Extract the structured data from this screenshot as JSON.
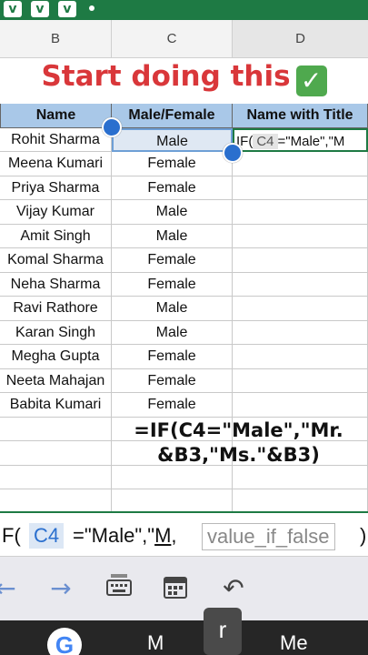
{
  "top_badges": [
    "v",
    "v",
    "v"
  ],
  "columns": [
    {
      "letter": "B",
      "selected": false
    },
    {
      "letter": "C",
      "selected": false
    },
    {
      "letter": "D",
      "selected": true
    }
  ],
  "title": "Start doing this",
  "title_icon": "check-mark-icon",
  "table": {
    "headers": [
      "Name",
      "Male/Female",
      "Name with Title"
    ],
    "rows": [
      [
        "Rohit Sharma",
        "Male"
      ],
      [
        "Meena Kumari",
        "Female"
      ],
      [
        "Priya Sharma",
        "Female"
      ],
      [
        "Vijay Kumar",
        "Male"
      ],
      [
        "Amit Singh",
        "Male"
      ],
      [
        "Komal Sharma",
        "Female"
      ],
      [
        "Neha Sharma",
        "Female"
      ],
      [
        "Ravi Rathore",
        "Male"
      ],
      [
        "Karan Singh",
        "Male"
      ],
      [
        "Megha Gupta",
        "Female"
      ],
      [
        "Neeta Mahajan",
        "Female"
      ],
      [
        "Babita Kumari",
        "Female"
      ]
    ],
    "formula_cell": {
      "prefix": "IF(",
      "ref": "C4",
      "suffix": "=\"Male\",\"M"
    }
  },
  "formula_caption": [
    "=IF(C4=\"Male\",\"Mr.",
    "&B3,\"Ms.\"&B3)"
  ],
  "formula_bar": {
    "prefix": "F(",
    "ref": "C4",
    "middle": "=\"Male\",\"",
    "underlined": "M",
    "after": ",",
    "hint": "value_if_false",
    "close": ")"
  },
  "keyboard_toolbar": {
    "left_arrow": "←",
    "right_arrow": "→",
    "undo": "↶"
  },
  "bottom_bar": {
    "g_label": "G",
    "key_left": "M",
    "key_popup": "r",
    "key_right": "Me"
  },
  "colors": {
    "excel_green": "#1e7a44",
    "title_red": "#d9373a",
    "header_blue": "#a9c8e8",
    "handle_blue": "#2a6fce"
  }
}
